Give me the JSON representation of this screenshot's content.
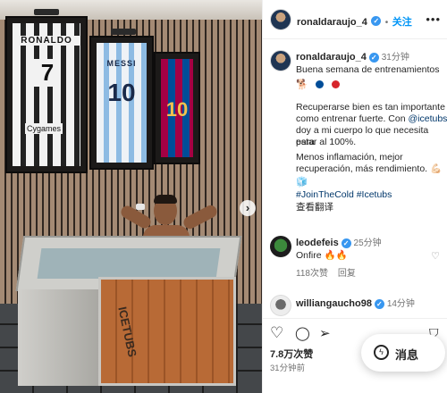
{
  "header": {
    "username": "ronaldaraujo_4",
    "separator": "•",
    "follow_label": "关注",
    "more_label": "•••"
  },
  "photo": {
    "jersey_left_name": "RONALDO",
    "jersey_left_number": "7",
    "jersey_left_sponsor": "Cygames",
    "jersey_mid_name": "MESSI",
    "jersey_mid_number": "10",
    "jersey_right_number": "10",
    "tub_brand": "ICETUBS",
    "next_label": "›"
  },
  "caption": {
    "username": "ronaldaraujo_4",
    "time": "31分钟",
    "line1": "Buena semana de entrenamientos",
    "emoji_dog": "🐕",
    "dot_colors": [
      "#004d98",
      "#a50044"
    ],
    "p1": "Recuperarse bien es tan importante",
    "p2a": "como entrenar fuerte. Con ",
    "p2_link": "@icetubs",
    "p2b": " ,",
    "p3": "doy a mi cuerpo lo que necesita para",
    "p4": "estar al 100%.",
    "p5": "Menos inflamación, mejor",
    "p6": "recuperación, más rendimiento. 💪🏻",
    "ice": "🧊",
    "hashtags": "#JoinTheCold #Icetubs",
    "translate": "查看翻译"
  },
  "comments": [
    {
      "username": "leodefeis",
      "time": "25分钟",
      "text": "Onfire 🔥🔥",
      "likes": "118次赞",
      "reply": "回复"
    },
    {
      "username": "williangaucho98",
      "time": "14分钟"
    }
  ],
  "actions": {
    "like_icon": "heart-icon",
    "comment_icon": "comment-icon",
    "share_icon": "send-icon",
    "save_icon": "bookmark-icon",
    "like_glyph": "♡",
    "comment_glyph": "◯",
    "share_glyph": "➢",
    "save_glyph": "⛉",
    "likes": "7.8万次赞",
    "posted": "31分钟前"
  },
  "messages": {
    "label": "消息",
    "icon_glyph": "ϟ"
  }
}
